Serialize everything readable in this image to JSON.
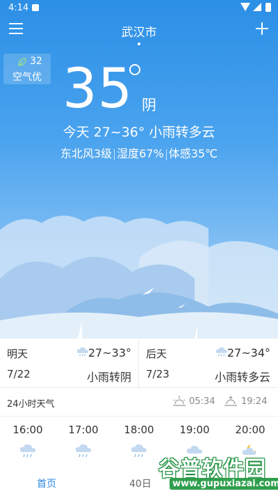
{
  "status": {
    "time": "4:14"
  },
  "header": {
    "city": "武汉市"
  },
  "aqi": {
    "value": "32",
    "level": "空气优"
  },
  "current": {
    "temp": "35",
    "condition": "阴",
    "today": "今天 27~36° 小雨转多云",
    "wind": "东北风3级",
    "humidity": "湿度67%",
    "feels": "体感35℃"
  },
  "forecast": [
    {
      "label": "明天",
      "date": "7/22",
      "range": "27~33°",
      "text": "小雨转阴"
    },
    {
      "label": "后天",
      "date": "7/23",
      "range": "27~34°",
      "text": "小雨转多云"
    }
  ],
  "hourly_title": "24小时天气",
  "sun": {
    "sunrise": "05:34",
    "sunset": "19:24"
  },
  "hours": [
    "16:00",
    "17:00",
    "18:00",
    "19:00",
    "20:00"
  ],
  "tabs": {
    "home": "首页",
    "forty": "40日"
  },
  "watermark": {
    "brand": "谷普软件园",
    "url": "www.gupuxiazai.com"
  },
  "colors": {
    "accent": "#2d87e3",
    "sky_top": "#2b8fe6"
  }
}
